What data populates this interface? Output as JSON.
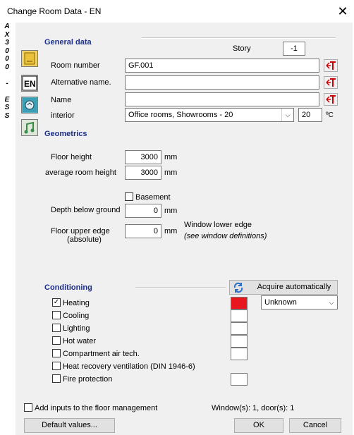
{
  "window": {
    "title": "Change Room Data - EN",
    "vertical_label": [
      "A",
      "X",
      "3",
      "0",
      "0",
      "0",
      "",
      "-",
      "",
      "E",
      "S",
      "S"
    ]
  },
  "general": {
    "heading": "General data",
    "story_label": "Story",
    "story_value": "-1",
    "room_number_label": "Room number",
    "room_number_value": "GF.001",
    "alt_name_label": "Alternative name.",
    "alt_name_value": "",
    "name_label": "Name",
    "name_value": "",
    "interior_label": "interior",
    "interior_value": "Office rooms, Showrooms - 20",
    "temp_value": "20",
    "temp_unit": "ºC"
  },
  "geometrics": {
    "heading": "Geometrics",
    "floor_height_label": "Floor height",
    "floor_height_value": "3000",
    "avg_height_label": "average room height",
    "avg_height_value": "3000",
    "unit": "mm",
    "basement_label": "Basement",
    "depth_label": "Depth below ground",
    "depth_value": "0",
    "floor_upper_label_1": "Floor upper edge",
    "floor_upper_label_2": "(absolute)",
    "floor_upper_value": "0",
    "window_edge_label": "Window lower edge",
    "window_edge_note": "(see window definitions)"
  },
  "conditioning": {
    "heading": "Conditioning",
    "acquire_label": "Acquire automatically",
    "unknown_value": "Unknown",
    "heating": "Heating",
    "cooling": "Cooling",
    "lighting": "Lighting",
    "hot_water": "Hot water",
    "compartment": "Compartment air tech.",
    "heat_recovery": "Heat recovery ventilation (DIN 1946-6)",
    "fire": "Fire protection",
    "heating_color": "#e8161f"
  },
  "footer": {
    "floor_mgmt_label": "Add inputs to the floor management",
    "counts": "Window(s): 1, door(s): 1",
    "default_btn": "Default values...",
    "ok_btn": "OK",
    "cancel_btn": "Cancel"
  }
}
